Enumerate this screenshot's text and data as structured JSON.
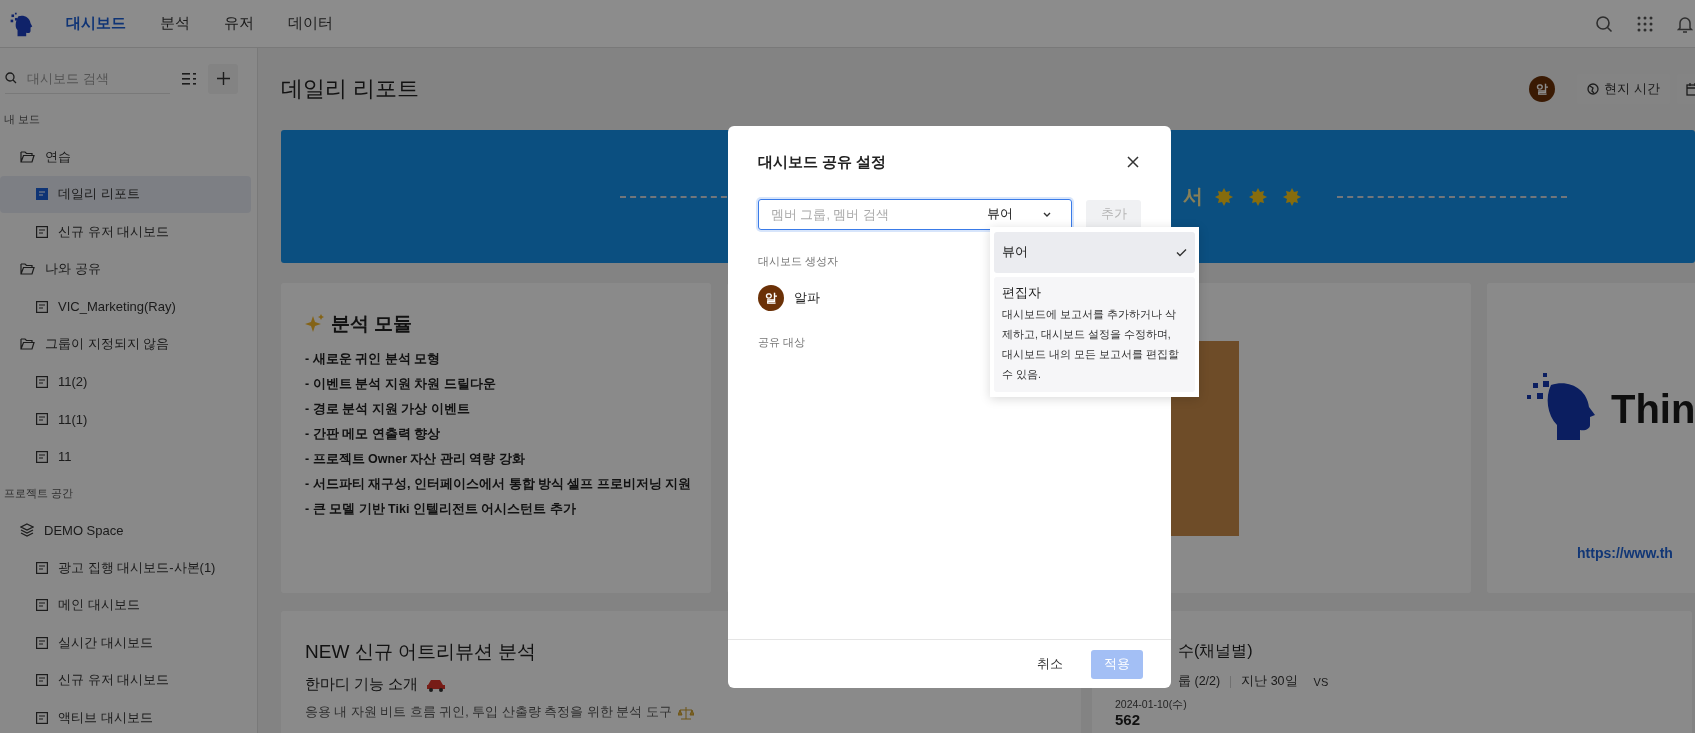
{
  "nav": {
    "tabs": [
      {
        "label": "대시보드",
        "selected": true
      },
      {
        "label": "분석",
        "selected": false
      },
      {
        "label": "유저",
        "selected": false
      },
      {
        "label": "데이터",
        "selected": false
      }
    ]
  },
  "sidebar": {
    "search": {
      "placeholder": "대시보드 검색"
    },
    "sections": [
      {
        "title": "내 보드",
        "groups": [
          {
            "label": "연습",
            "kind": "folder",
            "children": [
              {
                "label": "데일리 리포트",
                "selected": true
              },
              {
                "label": "신규 유저 대시보드",
                "selected": false
              }
            ]
          },
          {
            "label": "나와 공유",
            "kind": "folder",
            "children": [
              {
                "label": "VIC_Marketing(Ray)",
                "selected": false
              }
            ]
          },
          {
            "label": "그룹이 지정되지 않음",
            "kind": "folder",
            "children": [
              {
                "label": "11(2)",
                "selected": false
              },
              {
                "label": "11(1)",
                "selected": false
              },
              {
                "label": "11",
                "selected": false
              }
            ]
          }
        ]
      },
      {
        "title": "프로젝트 공간",
        "groups": [
          {
            "label": "DEMO Space",
            "kind": "space",
            "children": [
              {
                "label": "광고 집행 대시보드-사본(1)",
                "selected": false
              },
              {
                "label": "메인 대시보드",
                "selected": false
              },
              {
                "label": "실시간 대시보드",
                "selected": false
              },
              {
                "label": "신규 유저 대시보드",
                "selected": false
              },
              {
                "label": "액티브 대시보드",
                "selected": false
              }
            ]
          }
        ]
      }
    ]
  },
  "page": {
    "title": "데일리 리포트",
    "avatar": "알",
    "timezone_button": "현지 시간"
  },
  "banner": {
    "text": "서"
  },
  "analysis_card": {
    "title": "분석 모듈",
    "items": [
      "- 새로운 귀인 분석 모형",
      "- 이벤트 분석 지원 차원 드릴다운",
      "- 경로 분석 지원 가상 이벤트",
      "- 간판 메모 연출력 향상",
      "- 프로젝트 Owner 자산 관리 역량 강화",
      "- 서드파티 재구성, 인터페이스에서 통합 방식 셀프 프로비저닝 지원",
      "- 큰 모델 기반 Tiki 인텔리전트 어시스턴트 추가"
    ]
  },
  "logo_card": {
    "logo_text": "Thin",
    "link": "https://www.th"
  },
  "attribution_card": {
    "title": "NEW 신규 어트리뷰션 분석",
    "subtitle": "한마디 기능 소개",
    "text": "응용 내 자원 비트 흐름 귀인, 투입 산출량 측정을 위한 분석 도구"
  },
  "channel_card": {
    "title": "수(채널별)",
    "filter": "룹 (2/2)",
    "period": "지난 30일",
    "compare": "VS",
    "date": "2024-01-10(수)",
    "value": "562"
  },
  "modal": {
    "title": "대시보드 공유 설정",
    "search": {
      "placeholder": "멤버 그룹, 멤버 검색"
    },
    "role": "뷰어",
    "add_button": {
      "label": "추가",
      "disabled": true
    },
    "creator_label": "대시보드 생성자",
    "creator": {
      "avatar": "알",
      "name": "알파"
    },
    "shared_label": "공유 대상",
    "role_options": [
      {
        "label": "뷰어",
        "selected": true
      },
      {
        "label": "편집자",
        "selected": false,
        "description": "대시보드에 보고서를 추가하거나 삭제하고, 대시보드 설정을 수정하며, 대시보드 내의 모든 보고서를 편집할 수 있음."
      }
    ],
    "cancel_button": "취소",
    "apply_button": {
      "label": "적용",
      "disabled": true
    }
  }
}
